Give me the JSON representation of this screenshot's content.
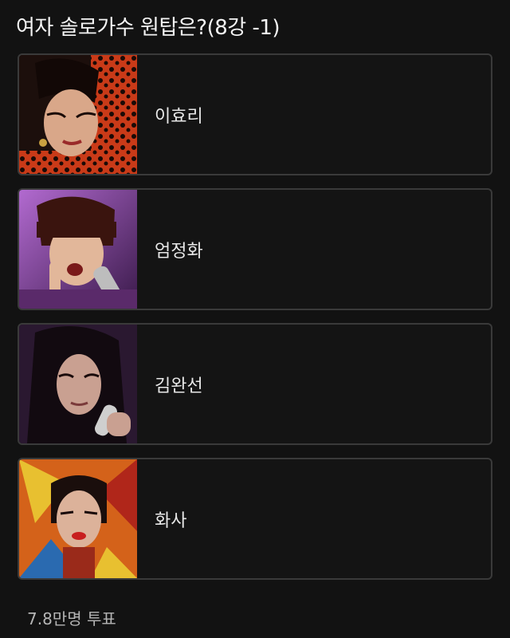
{
  "poll": {
    "title": "여자 솔로가수 원탑은?(8강 -1)",
    "options": [
      {
        "label": "이효리",
        "photo": "portrait-photo-leopard-outfit",
        "accent": "#d23a1c"
      },
      {
        "label": "엄정화",
        "photo": "portrait-photo-bob-hair-microphone",
        "accent": "#8a3aa8"
      },
      {
        "label": "김완선",
        "photo": "portrait-photo-long-dark-hair-microphone",
        "accent": "#5a3a6a"
      },
      {
        "label": "화사",
        "photo": "portrait-photo-red-lips-colorful-background",
        "accent": "#e0a020"
      }
    ],
    "vote_count": "7.8만명 투표"
  }
}
